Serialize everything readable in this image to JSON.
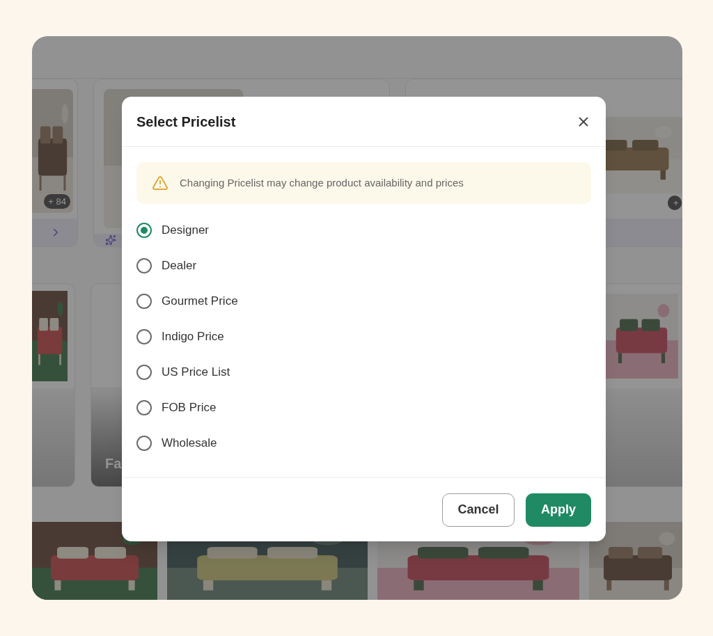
{
  "background": {
    "row1_badges": [
      "+ 84",
      "+"
    ],
    "row2_caption": "Fa"
  },
  "dialog": {
    "title": "Select Pricelist",
    "notice": "Changing Pricelist may change product availability and prices",
    "options": [
      {
        "label": "Designer",
        "selected": true
      },
      {
        "label": "Dealer",
        "selected": false
      },
      {
        "label": "Gourmet Price",
        "selected": false
      },
      {
        "label": "Indigo Price",
        "selected": false
      },
      {
        "label": "US Price List",
        "selected": false
      },
      {
        "label": "FOB Price",
        "selected": false
      },
      {
        "label": "Wholesale",
        "selected": false
      }
    ],
    "buttons": [
      {
        "label": "Cancel",
        "kind": "secondary"
      },
      {
        "label": "Apply",
        "kind": "primary"
      }
    ]
  }
}
